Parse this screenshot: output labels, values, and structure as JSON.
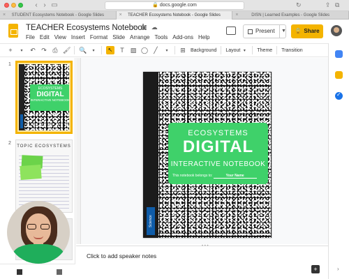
{
  "browser": {
    "url": "docs.google.com",
    "tabs": [
      {
        "label": "STUDENT Ecosystems Notebook - Google Slides",
        "active": false
      },
      {
        "label": "TEACHER Ecosystems Notebook - Google Slides",
        "active": true
      },
      {
        "label": "DISN | Learned Examples - Google Slides",
        "active": false
      }
    ]
  },
  "doc": {
    "title": "TEACHER Ecosystems Notebook",
    "menu": [
      "File",
      "Edit",
      "View",
      "Insert",
      "Format",
      "Slide",
      "Arrange",
      "Tools",
      "Add-ons",
      "Help"
    ],
    "present_label": "Present",
    "share_label": "Share"
  },
  "toolbar": {
    "background_label": "Background",
    "layout_label": "Layout",
    "theme_label": "Theme",
    "transition_label": "Transition",
    "zoom_symbol": "🔍"
  },
  "filmstrip": {
    "slide_numbers": [
      "1",
      "2"
    ],
    "slide2_title": "TOPIC ECOSYSTEMS"
  },
  "slide": {
    "line1": "ECOSYSTEMS",
    "line2": "DIGITAL",
    "line3": "INTERACTIVE NOTEBOOK",
    "owner_prefix": "This notebook belongs to:",
    "owner_field": "Your Name",
    "spine_label": "Science"
  },
  "notes": {
    "placeholder": "Click to add speaker notes"
  },
  "colors": {
    "accent_yellow": "#f4b400",
    "cover_green": "#3fd16a",
    "spine_blue": "#0f5ca8"
  }
}
